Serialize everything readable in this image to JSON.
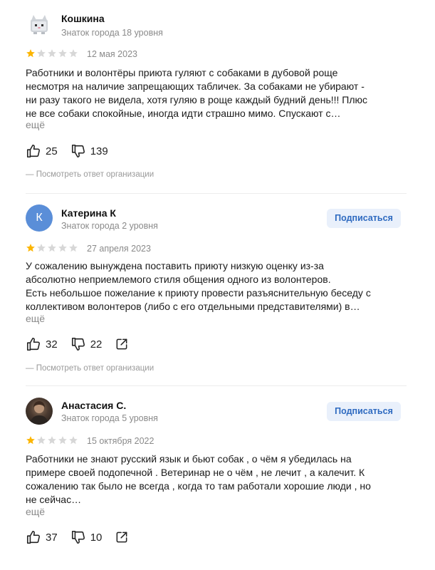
{
  "reviews": [
    {
      "name": "Кошкина",
      "rank": "Знаток города 18 уровня",
      "rating": 1,
      "date": "12 мая 2023",
      "text": "Работники и волонтёры приюта гуляют с собаками в дубовой роще\nнесмотря на наличие запрещающих табличек. За собаками не убирают -\nни разу такого не видела, хотя гуляю в роще каждый будний день!!! Плюс\nне все собаки спокойные, иногда идти страшно мимо. Спускают с…",
      "more": "ещё",
      "likes": "25",
      "dislikes": "139",
      "org_reply": "— Посмотреть ответ организации",
      "avatar": "cat-sticker"
    },
    {
      "name": "Катерина К",
      "rank": "Знаток города 2 уровня",
      "avatar_letter": "К",
      "subscribe": "Подписаться",
      "rating": 1,
      "date": "27 апреля 2023",
      "text": "У сожалению вынуждена поставить приюту низкую оценку из-за\nабсолютно неприемлемого стиля общения одного из волонтеров.\nЕсть небольшое пожелание к приюту провести разъяснительную беседу с\nколлективом волонтеров (либо с его отдельными представителями) в…",
      "more": "ещё",
      "likes": "32",
      "dislikes": "22",
      "org_reply": "— Посмотреть ответ организации"
    },
    {
      "name": "Анастасия С.",
      "rank": "Знаток города 5 уровня",
      "subscribe": "Подписаться",
      "rating": 1,
      "date": "15 октября 2022",
      "text": "Работники не знают русский язык и бьют собак , о чём я убедилась на\nпримере своей подопечной . Ветеринар не о чём , не лечит , а калечит. К\nсожалению так было не всегда , когда то там работали хорошие люди , но\nне сейчас…",
      "more": "ещё",
      "likes": "37",
      "dislikes": "10",
      "avatar": "photo"
    }
  ],
  "icons": {
    "like": "thumbs-up-icon",
    "dislike": "thumbs-down-icon",
    "share": "share-icon",
    "star_filled": "star-filled-icon",
    "star_empty": "star-empty-icon"
  },
  "colors": {
    "star_filled": "#fcb500",
    "star_empty": "#d7d7d7",
    "subscribe_bg": "#e9f0fb",
    "subscribe_text": "#2e6ac0",
    "avatar_letter_bg": "#5a8ed8"
  }
}
